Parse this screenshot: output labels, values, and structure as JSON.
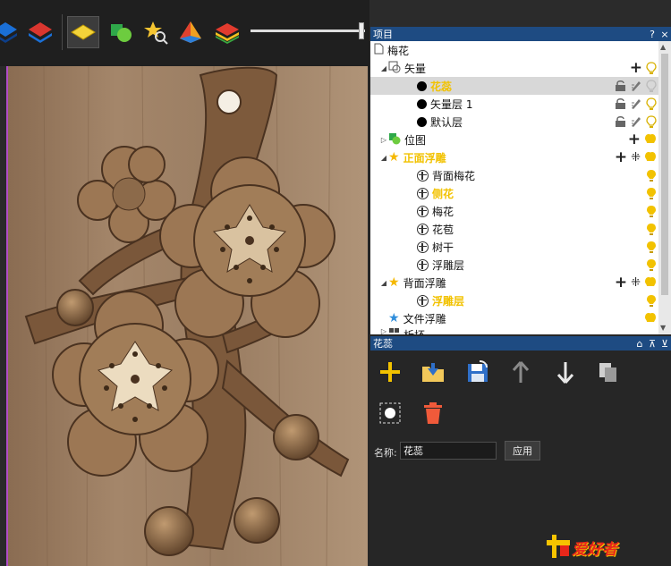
{
  "toolbar": {
    "tools": [
      "layers-blue-icon",
      "layers-red-icon",
      "diamond-yellow-icon",
      "shapes-icon",
      "star-search-icon",
      "pyramid-icon",
      "color-layers-icon"
    ],
    "slider_value": 0.98
  },
  "panel": {
    "title": "项目",
    "help": "?",
    "close": "×"
  },
  "tree": {
    "root": "梅花",
    "vector_group": "矢量",
    "vector_items": [
      "花蕊",
      "矢量层 1",
      "默认层"
    ],
    "bitmap": "位图",
    "front_relief": "正面浮雕",
    "front_items": [
      "背面梅花",
      "侧花",
      "梅花",
      "花苞",
      "树干",
      "浮雕层"
    ],
    "back_relief": "背面浮雕",
    "back_items": [
      "浮雕层"
    ],
    "file_relief": "文件浮雕",
    "partial": "析坯"
  },
  "subpanel": {
    "title": "花蕊",
    "name_label": "名称:",
    "name_value": "花蕊",
    "apply_label": "应用"
  },
  "watermark": {
    "text": "爱好者"
  },
  "colors": {
    "titlebar": "#1e4b82",
    "highlight": "#f2c200",
    "canvas_wood": "#9a7b5e"
  }
}
